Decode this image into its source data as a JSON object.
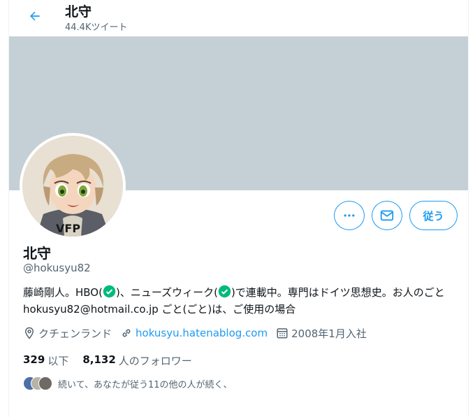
{
  "header": {
    "title": "北守",
    "tweet_count": "44.4Kツイート"
  },
  "profile": {
    "name": "北守",
    "handle": "@hokusyu82",
    "bio": {
      "part1": "藤崎剛人。HBO(",
      "part2": ")、ニューズウィーク(",
      "part3": ")で連載中。専門はドイツ思想史。お人のごと hokusyu82@hotmail.co.jp ごと(ごと)は、ご使用の場合"
    },
    "location": "クチェンランド",
    "website": "hokusyu.hatenablog.com",
    "joined": "2008年1月入社"
  },
  "actions": {
    "follow_label": "従う"
  },
  "stats": {
    "following_count": "329",
    "following_label": "以下",
    "followers_count": "8,132",
    "followers_label": "人のフォロワー"
  },
  "followed_by": {
    "text": "続いて、あなたが従う11の他の人が続く、"
  },
  "colors": {
    "accent": "#1d9bf0",
    "banner": "#c5d0d6",
    "verified": "#00ba7c"
  },
  "icons": [
    "back-arrow-icon",
    "more-icon",
    "mail-icon",
    "location-icon",
    "link-icon",
    "calendar-icon",
    "verified-icon"
  ]
}
